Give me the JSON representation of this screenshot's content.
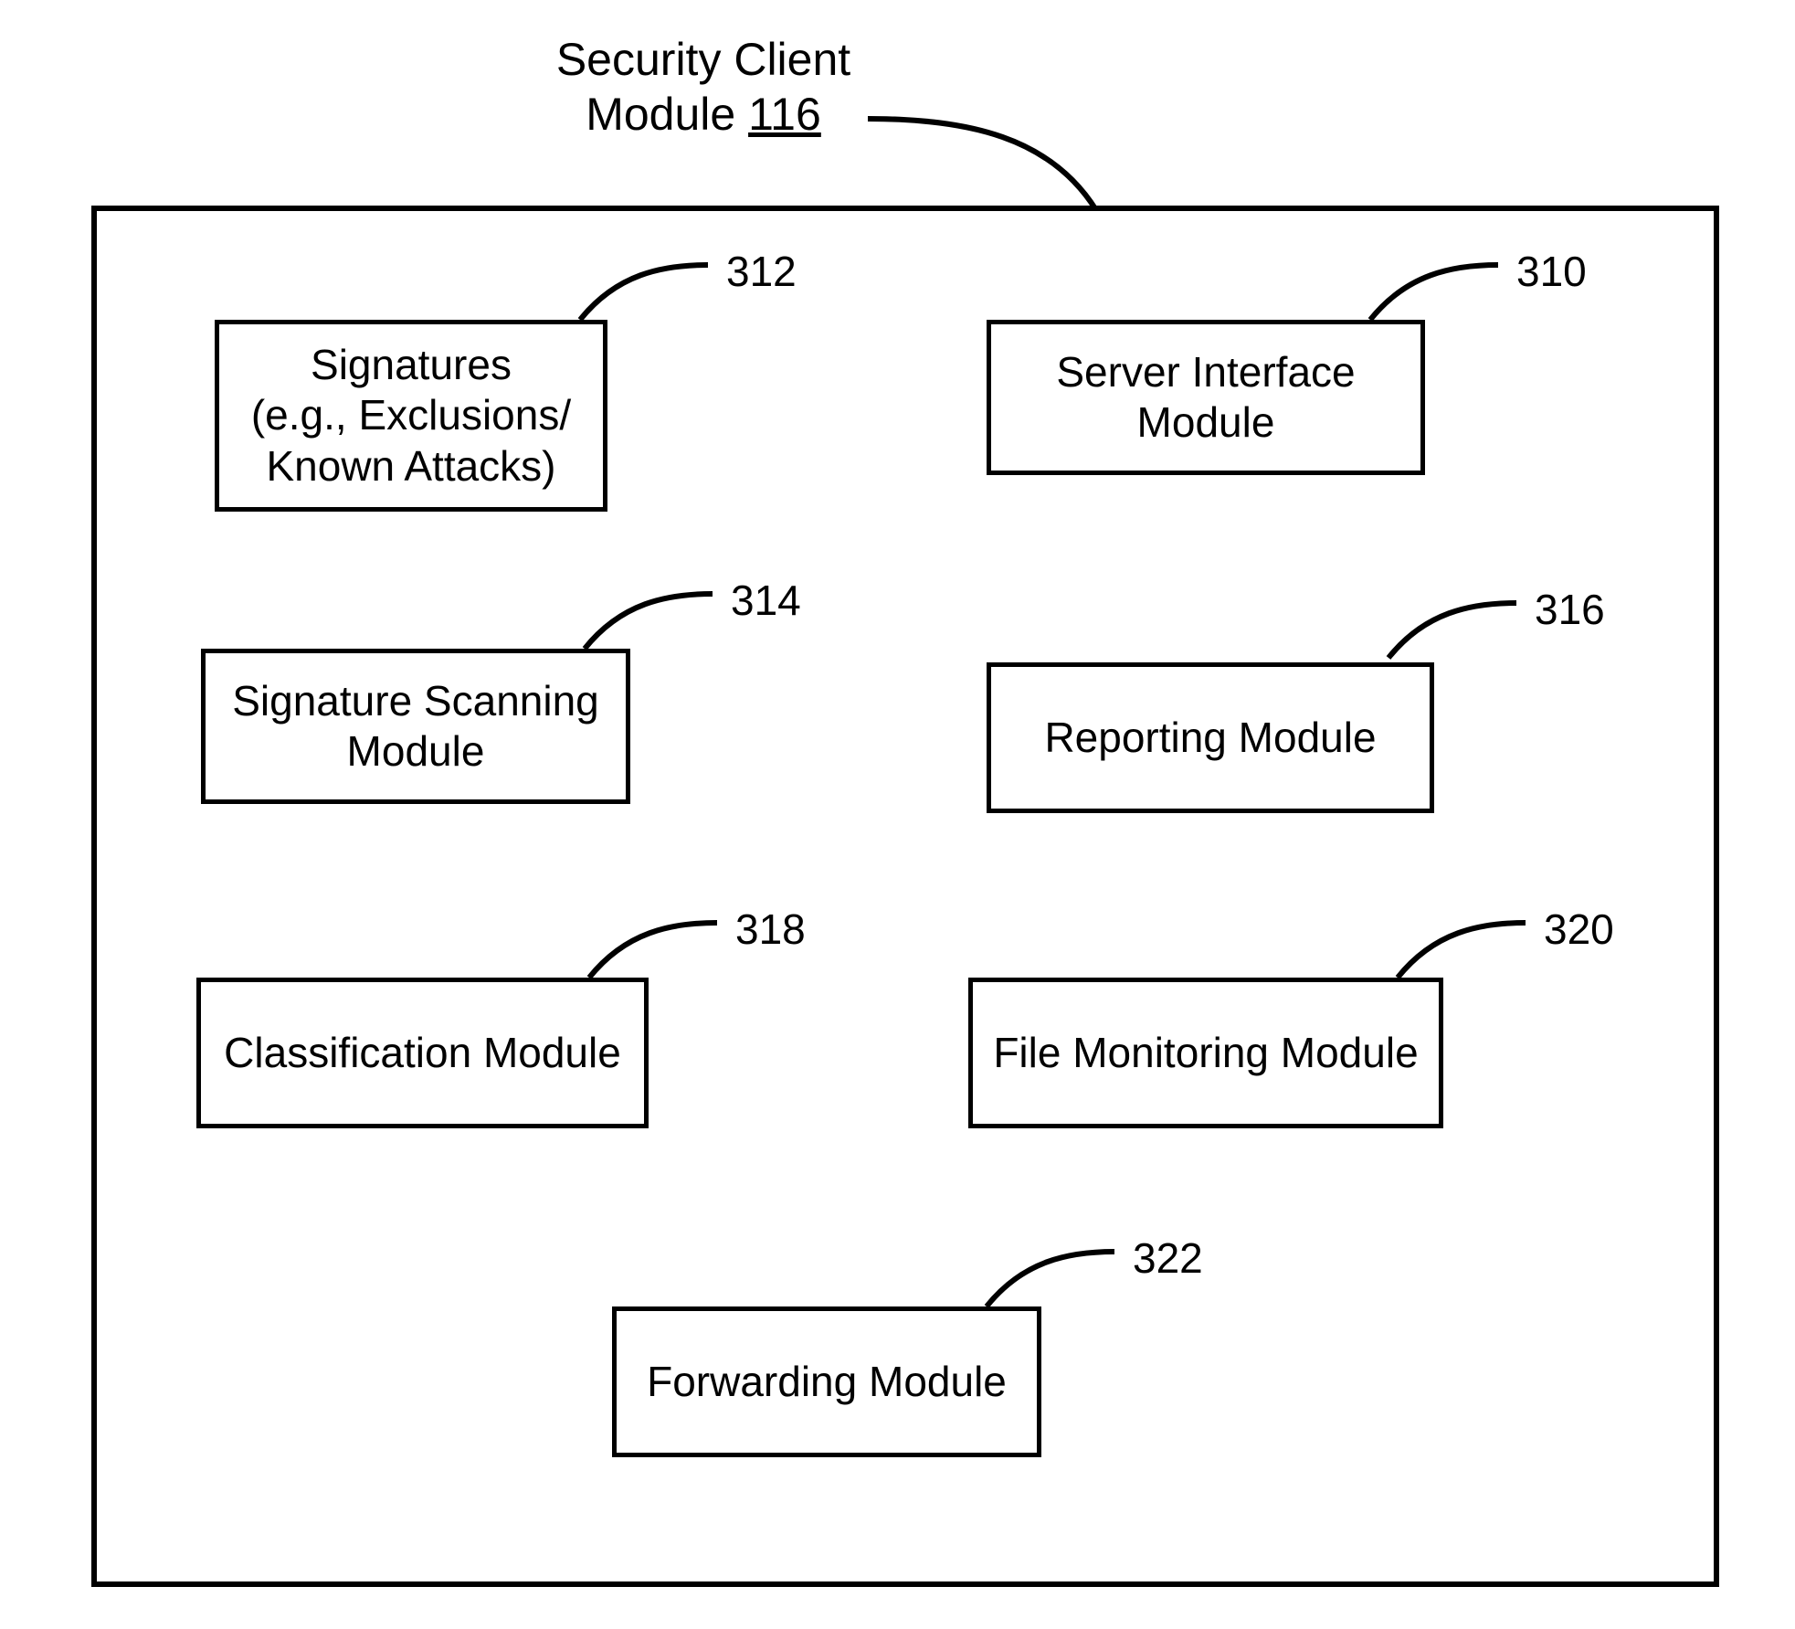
{
  "title": {
    "line1": "Security Client",
    "line2_prefix": "Module ",
    "line2_number": "116"
  },
  "container": {},
  "modules": {
    "signatures": {
      "ref": "312",
      "line1": "Signatures",
      "line2": "(e.g., Exclusions/",
      "line3": "Known Attacks)"
    },
    "server_interface": {
      "ref": "310",
      "line1": "Server Interface",
      "line2": "Module"
    },
    "signature_scanning": {
      "ref": "314",
      "line1": "Signature Scanning",
      "line2": "Module"
    },
    "reporting": {
      "ref": "316",
      "line1": "Reporting Module"
    },
    "classification": {
      "ref": "318",
      "line1": "Classification Module"
    },
    "file_monitoring": {
      "ref": "320",
      "line1": "File Monitoring Module"
    },
    "forwarding": {
      "ref": "322",
      "line1": "Forwarding Module"
    }
  }
}
